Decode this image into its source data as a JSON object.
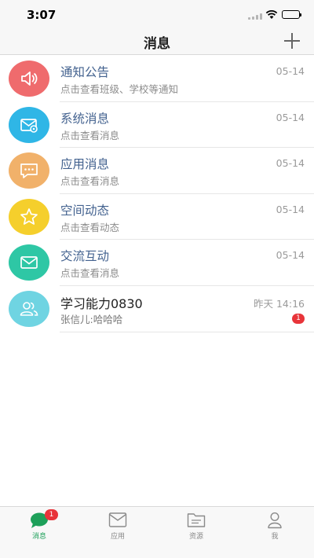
{
  "status_bar": {
    "time": "3:07",
    "battery_level": 1.0
  },
  "nav": {
    "title": "消息",
    "add_icon": "plus-icon"
  },
  "messages": [
    {
      "title": "通知公告",
      "subtitle": "点击查看班级、学校等通知",
      "date": "05-14",
      "icon": "speaker-icon",
      "color": "#ef6b6d"
    },
    {
      "title": "系统消息",
      "subtitle": "点击查看消息",
      "date": "05-14",
      "icon": "gear-envelope-icon",
      "color": "#2fb6e6"
    },
    {
      "title": "应用消息",
      "subtitle": "点击查看消息",
      "date": "05-14",
      "icon": "chat-bubble-icon",
      "color": "#f1b16a"
    },
    {
      "title": "空间动态",
      "subtitle": "点击查看动态",
      "date": "05-14",
      "icon": "star-icon",
      "color": "#f5cf2c"
    },
    {
      "title": "交流互动",
      "subtitle": "点击查看消息",
      "date": "05-14",
      "icon": "envelope-icon",
      "color": "#2ec7a5"
    },
    {
      "title": "学习能力0830",
      "subtitle": "张信儿:哈哈哈",
      "date": "昨天 14:16",
      "icon": "group-icon",
      "color": "#6fd4e2",
      "unread": "1"
    }
  ],
  "tabs": [
    {
      "label": "消息",
      "icon": "message-icon",
      "badge": "1",
      "active": true
    },
    {
      "label": "应用",
      "icon": "apps-icon"
    },
    {
      "label": "资源",
      "icon": "folder-icon"
    },
    {
      "label": "我",
      "icon": "user-icon"
    }
  ],
  "colors": {
    "accent": "#1ea05a",
    "badge": "#e8343a",
    "title_blue": "#43628f"
  }
}
